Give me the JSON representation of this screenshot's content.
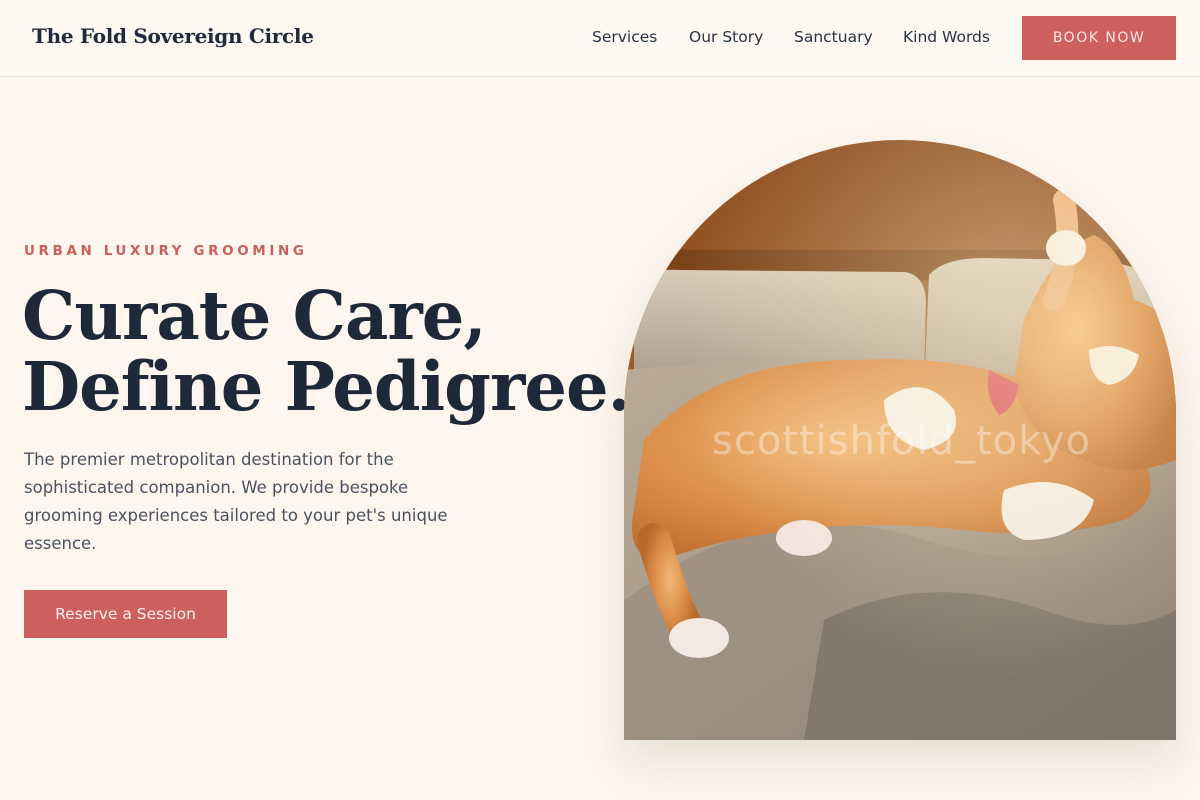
{
  "brand": {
    "name": "The Fold Sovereign Circle"
  },
  "nav": {
    "links": [
      "Services",
      "Our Story",
      "Sanctuary",
      "Kind Words"
    ],
    "book_label": "BOOK NOW"
  },
  "hero": {
    "eyebrow": "URBAN LUXURY GROOMING",
    "headline_line1": "Curate Care,",
    "headline_line2": "Define Pedigree.",
    "lead": "The premier metropolitan destination for the sophisticated companion. We provide bespoke grooming experiences tailored to your pet's unique essence.",
    "cta_label": "Reserve a Session",
    "image": {
      "subject": "orange and white cat stretching on a beige sofa in sunlight",
      "watermark": "scottishfold_tokyo"
    }
  },
  "colors": {
    "background": "#fdf6ee",
    "accent": "#cd5f5c",
    "heading": "#1e2839",
    "body_text": "#4a5263"
  }
}
